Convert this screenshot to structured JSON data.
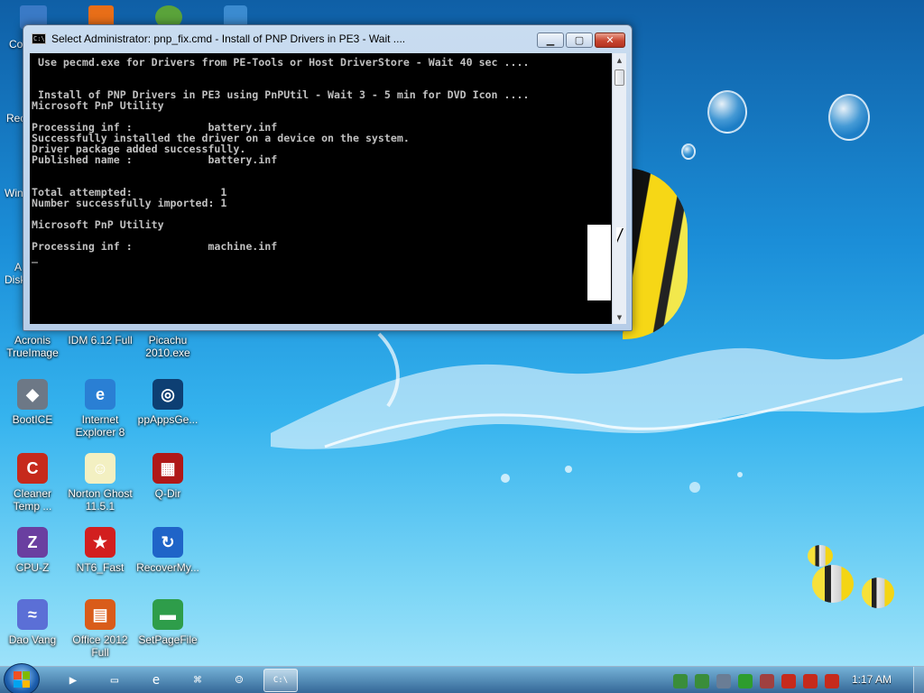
{
  "window": {
    "title": "Select Administrator:  pnp_fix.cmd - Install of PNP Drivers in PE3 - Wait ....",
    "console_lines": [
      " Use pecmd.exe for Drivers from PE-Tools or Host DriverStore - Wait 40 sec ....",
      "",
      "",
      " Install of PNP Drivers in PE3 using PnPUtil - Wait 3 - 5 min for DVD Icon ....",
      "Microsoft PnP Utility",
      "",
      "Processing inf :            battery.inf",
      "Successfully installed the driver on a device on the system.",
      "Driver package added successfully.",
      "Published name :            battery.inf",
      "",
      "",
      "Total attempted:              1",
      "Number successfully imported: 1",
      "",
      "Microsoft PnP Utility",
      "",
      "Processing inf :            machine.inf",
      "_"
    ],
    "controls": {
      "minimize": "minimize",
      "maximize": "maximize",
      "close": "close"
    }
  },
  "desktop_icons": [
    {
      "id": "acronis",
      "label": "Acronis TrueImage",
      "icon": "acronis-icon",
      "color": "#2f6db5"
    },
    {
      "id": "idm",
      "label": "IDM 6.12 Full",
      "icon": "idm-icon",
      "color": "#3c8c2f"
    },
    {
      "id": "picachu",
      "label": "Picachu 2010.exe",
      "icon": "picachu-icon",
      "color": "#d6a21c"
    },
    {
      "id": "bootice",
      "label": "BootICE",
      "icon": "bootice-icon",
      "color": "#6d7886"
    },
    {
      "id": "ie8",
      "label": "Internet Explorer 8",
      "icon": "internet-explorer-icon",
      "color": "#2a7fd4"
    },
    {
      "id": "ppapps",
      "label": "ppAppsGe...",
      "icon": "ppapps-icon",
      "color": "#0d3f73"
    },
    {
      "id": "cleaner",
      "label": "Cleaner Temp ...",
      "icon": "cleaner-icon",
      "color": "#c62a1c"
    },
    {
      "id": "norton",
      "label": "Norton Ghost 11.5.1",
      "icon": "ghost-icon",
      "color": "#f3f0c2"
    },
    {
      "id": "qdir",
      "label": "Q-Dir",
      "icon": "qdir-icon",
      "color": "#b01818"
    },
    {
      "id": "cpuz",
      "label": "CPU-Z",
      "icon": "cpuz-icon",
      "color": "#6a3fa0"
    },
    {
      "id": "nt6fast",
      "label": "NT6_Fast",
      "icon": "nt6-fast-icon",
      "color": "#d21f1f"
    },
    {
      "id": "recovermy",
      "label": "RecoverMy...",
      "icon": "recover-my-files-icon",
      "color": "#1f64c8"
    },
    {
      "id": "daovang",
      "label": "Dao Vang",
      "icon": "dao-vang-icon",
      "color": "#5b6fd6"
    },
    {
      "id": "office2012",
      "label": "Office 2012 Full",
      "icon": "office-icon",
      "color": "#d95c1a"
    },
    {
      "id": "setpagefile",
      "label": "SetPageFile",
      "icon": "setpagefile-icon",
      "color": "#2e9d4a"
    }
  ],
  "partial_labels": [
    "Co",
    "Rec",
    "Win",
    "A",
    "Disk"
  ],
  "taskbar": {
    "buttons": [
      {
        "icon": "media-player-icon",
        "glyph": "▶"
      },
      {
        "icon": "folder-icon",
        "glyph": "▭"
      },
      {
        "icon": "internet-explorer-icon",
        "glyph": "e"
      },
      {
        "icon": "network-icon",
        "glyph": "⌘"
      },
      {
        "icon": "ghost-icon",
        "glyph": "☺"
      },
      {
        "icon": "cmd-icon",
        "glyph": "C:\\"
      }
    ],
    "tray": [
      {
        "icon": "network-tray-icon",
        "color": "#3a8d3a"
      },
      {
        "icon": "safely-remove-icon",
        "color": "#3a8d3a"
      },
      {
        "icon": "display-icon",
        "color": "#6a7d95"
      },
      {
        "icon": "play-icon",
        "color": "#2e9d2e"
      },
      {
        "icon": "tools-icon",
        "color": "#a04040"
      },
      {
        "icon": "shield-icon",
        "color": "#c62a1c"
      },
      {
        "icon": "action-center-icon",
        "color": "#c62a1c"
      },
      {
        "icon": "mute-icon",
        "color": "#c62a1c"
      }
    ],
    "clock": "1:17 AM"
  }
}
